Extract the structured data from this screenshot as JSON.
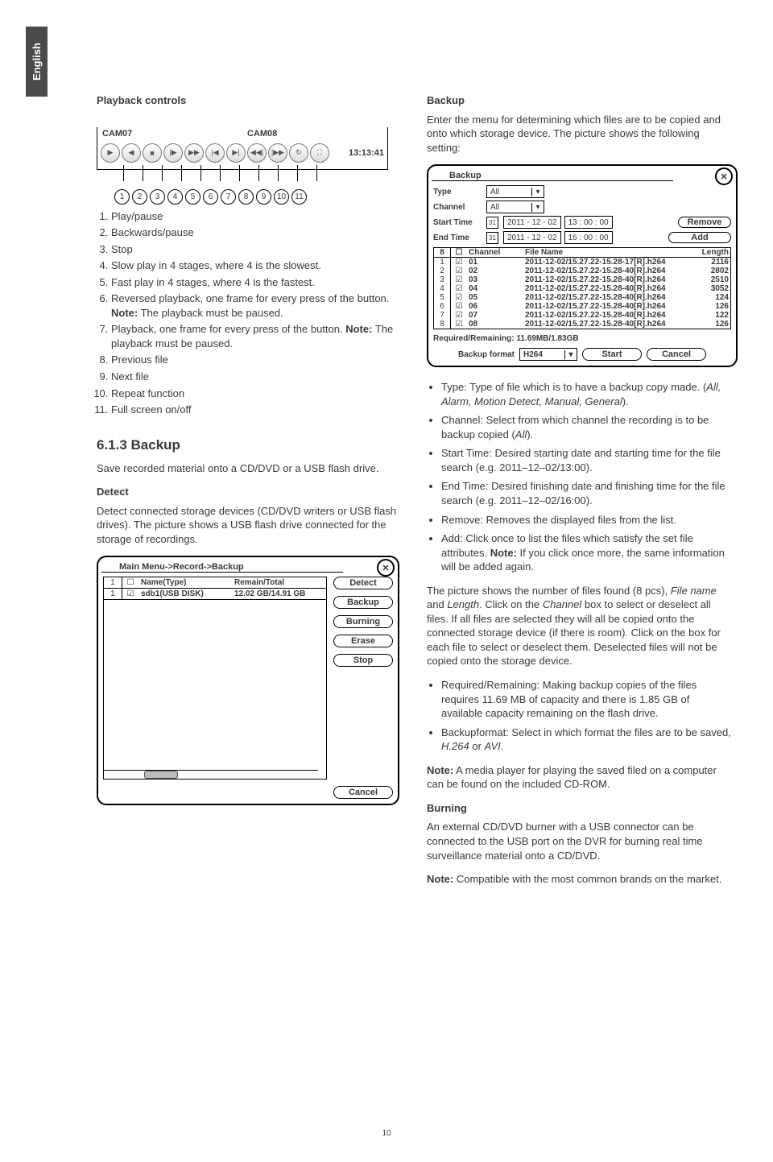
{
  "lang_tab": "English",
  "page_number": "10",
  "left": {
    "playback_heading": "Playback controls",
    "cam07": "CAM07",
    "cam08": "CAM08",
    "time": "13:13:41",
    "controls": [
      "Play/pause",
      "Backwards/pause",
      "Stop",
      "Slow play in 4 stages, where 4 is the slowest.",
      "Fast play in 4 stages, where 4 is the fastest.",
      "Reversed playback, one frame for every press of the button.",
      "Playback, one frame for every press of the button.",
      "Previous file",
      "Next file",
      "Repeat function",
      "Full screen on/off"
    ],
    "note_reversed": "The playback must be paused.",
    "note_playback": "The playback must be paused.",
    "section_backup_heading": "6.1.3 Backup",
    "section_backup_text": "Save recorded material onto a CD/DVD or a USB flash drive.",
    "detect_heading": "Detect",
    "detect_text": "Detect connected storage devices (CD/DVD writers or USB flash drives). The picture shows a USB flash drive connected for the storage of recordings.",
    "main_menu_title": "Main Menu->Record->Backup",
    "dt_head_name": "Name(Type)",
    "dt_head_remain": "Remain/Total",
    "dt_row_name": "sdb1(USB DISK)",
    "dt_row_remain": "12.02 GB/14.91 GB",
    "btn_detect": "Detect",
    "btn_backup": "Backup",
    "btn_burning": "Burning",
    "btn_erase": "Erase",
    "btn_stop": "Stop",
    "btn_cancel": "Cancel"
  },
  "right": {
    "backup_heading": "Backup",
    "backup_intro": "Enter the menu for determining which files are to be copied and onto which storage device. The picture shows the following setting:",
    "dialog": {
      "title": "Backup",
      "type_label": "Type",
      "type_value": "All",
      "channel_label": "Channel",
      "channel_value": "All",
      "start_label": "Start Time",
      "start_date": "2011 - 12 - 02",
      "start_time": "13 : 00 : 00",
      "end_label": "End Time",
      "end_date": "2011 - 12 - 02",
      "end_time": "16 : 00 : 00",
      "btn_remove": "Remove",
      "btn_add": "Add",
      "table_count": "8",
      "table_head_channel": "Channel",
      "table_head_filename": "File Name",
      "table_head_length": "Length",
      "rows": [
        {
          "n": "1",
          "ch": "01",
          "fn": "2011-12-02/15.27.22-15.28-17[R].h264",
          "len": "2116"
        },
        {
          "n": "2",
          "ch": "02",
          "fn": "2011-12-02/15.27.22-15.28-40[R].h264",
          "len": "2802"
        },
        {
          "n": "3",
          "ch": "03",
          "fn": "2011-12-02/15.27.22-15.28-40[R].h264",
          "len": "2510"
        },
        {
          "n": "4",
          "ch": "04",
          "fn": "2011-12-02/15.27.22-15.28-40[R].h264",
          "len": "3052"
        },
        {
          "n": "5",
          "ch": "05",
          "fn": "2011-12-02/15.27.22-15.28-40[R].h264",
          "len": "124"
        },
        {
          "n": "6",
          "ch": "06",
          "fn": "2011-12-02/15.27.22-15.28-40[R].h264",
          "len": "126"
        },
        {
          "n": "7",
          "ch": "07",
          "fn": "2011-12-02/15.27.22-15.28-40[R].h264",
          "len": "122"
        },
        {
          "n": "8",
          "ch": "08",
          "fn": "2011-12-02/15.27.22-15.28-40[R].h264",
          "len": "126"
        }
      ],
      "required_remaining": "Required/Remaining: 11.69MB/1.83GB",
      "format_label": "Backup format",
      "format_value": "H264",
      "btn_start": "Start",
      "btn_cancel": "Cancel"
    },
    "bullets1": {
      "type_pre": "Type: Type of file which is to have a backup copy made. (",
      "type_opts": "All, Alarm, Motion Detect, Manual, General",
      "type_post": ").",
      "channel_pre": "Channel: Select from which channel the recording is to be backup copied (",
      "channel_opt": "All",
      "channel_post": ").",
      "start": "Start Time: Desired starting date and starting time for the file search (e.g. 2011–12–02/13:00).",
      "end": "End Time: Desired finishing date and finishing time for the file search (e.g. 2011–12–02/16:00).",
      "remove": "Remove: Removes the displayed files from the list.",
      "add_pre": "Add: Click once to list the files which satisfy the set file attributes. ",
      "add_note": "Note:",
      "add_post": " If you click once more, the same information will be added again."
    },
    "para_files": "The picture shows the number of files found (8 pcs), ",
    "para_files_i1": "File name",
    "para_files_mid": " and ",
    "para_files_i2": "Length",
    "para_files_mid2": ". Click on the ",
    "para_files_i3": "Channel",
    "para_files_end": " box to select or deselect all files. If all files are selected they will all be copied onto the connected storage device (if there is room). Click on the box for each file to select or deselect them. Deselected files will not be copied onto the storage device.",
    "bullets2": {
      "req": "Required/Remaining: Making backup copies of the files requires 11.69 MB of capacity and there is 1.85 GB of available capacity remaining on the flash drive.",
      "format_pre": "Backupformat: Select in which format the files are to be saved, ",
      "format_i1": "H.264",
      "format_mid": " or ",
      "format_i2": "AVI",
      "format_post": "."
    },
    "note_media_pre": "Note:",
    "note_media": " A media player for playing the saved filed on a computer can be found on the included CD-ROM.",
    "burning_heading": "Burning",
    "burning_text": "An external CD/DVD burner with a USB connector can be connected to the USB port on the DVR for burning real time surveillance material onto a CD/DVD.",
    "note_compat_pre": "Note:",
    "note_compat": " Compatible with the most common brands on the market."
  }
}
